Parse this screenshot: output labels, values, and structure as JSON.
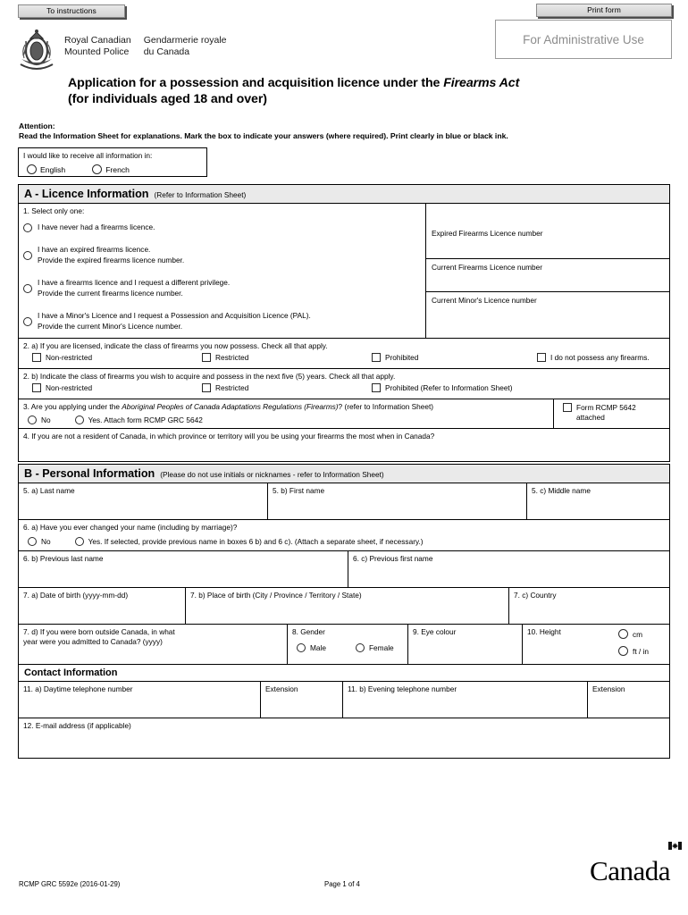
{
  "toolbar": {
    "to_instructions": "To instructions",
    "print_form": "Print form"
  },
  "admin": {
    "label": "For Administrative Use"
  },
  "org": {
    "name_en_line1": "Royal Canadian",
    "name_en_line2": "Mounted Police",
    "name_fr_line1": "Gendarmerie royale",
    "name_fr_line2": "du Canada"
  },
  "title": {
    "line1_a": "Application for a possession and acquisition licence under the ",
    "line1_italic": "Firearms Act",
    "line2": "(for individuals aged 18 and over)"
  },
  "attention": {
    "heading": "Attention:",
    "text": "Read the Information Sheet for explanations. Mark the box to indicate your answers (where required). Print clearly in blue or black ink."
  },
  "language": {
    "label": "I would like to receive all information in:",
    "options": [
      "English",
      "French"
    ]
  },
  "section_a": {
    "title": "A - Licence Information",
    "note": "(Refer to Information Sheet)",
    "q1": {
      "label": "1. Select only one:",
      "options": [
        {
          "line1": "I have never had a firearms licence.",
          "line2": ""
        },
        {
          "line1": "I have an expired firearms licence.",
          "line2": "Provide the expired firearms licence number."
        },
        {
          "line1": "I have a firearms licence and I request a different privilege.",
          "line2": "Provide the current firearms licence number."
        },
        {
          "line1": "I have a Minor's Licence and I request a Possession and Acquisition Licence (PAL).",
          "line2": "Provide the current Minor's Licence number."
        }
      ],
      "licence_boxes": [
        "Expired Firearms Licence number",
        "Current Firearms Licence number",
        "Current Minor's Licence number"
      ]
    },
    "q2a": {
      "label": "2. a) If you are licensed, indicate the class of firearms you now possess. Check all that apply.",
      "options": [
        "Non-restricted",
        "Restricted",
        "Prohibited",
        "I do not possess any firearms."
      ]
    },
    "q2b": {
      "label": "2. b) Indicate the class of firearms you wish to acquire and possess in the next five (5) years. Check all that apply.",
      "options": [
        "Non-restricted",
        "Restricted",
        "Prohibited (Refer to Information Sheet)"
      ]
    },
    "q3": {
      "label_a": "3. Are you applying under the ",
      "label_italic": "Aboriginal Peoples of Canada Adaptations Regulations (Firearms)",
      "label_b": "? (refer to Information Sheet)",
      "options": [
        "No",
        "Yes. Attach form RCMP GRC 5642"
      ],
      "attached_label_line1": "Form RCMP 5642",
      "attached_label_line2": "attached"
    },
    "q4": {
      "label": "4. If you are not a resident of Canada, in which province or territory will you be using your firearms the most when in Canada?"
    }
  },
  "section_b": {
    "title": "B - Personal Information",
    "note": "(Please do not use initials or nicknames - refer to Information Sheet)",
    "q5a": "5. a) Last name",
    "q5b": "5. b) First name",
    "q5c": "5. c) Middle name",
    "q6a": {
      "label": "6. a) Have you ever changed your name (including by marriage)?",
      "options": [
        "No",
        "Yes. If selected, provide previous name in boxes 6 b) and 6 c). (Attach a separate sheet, if necessary.)"
      ]
    },
    "q6b": "6. b) Previous last name",
    "q6c": "6. c) Previous first name",
    "q7a": "7. a) Date of birth (yyyy-mm-dd)",
    "q7b": "7. b) Place of birth (City / Province / Territory / State)",
    "q7c": "7. c) Country",
    "q7d_line1": "7. d) If you were born outside Canada, in what",
    "q7d_line2": "year were you admitted to Canada? (yyyy)",
    "q8": {
      "label": "8. Gender",
      "options": [
        "Male",
        "Female"
      ]
    },
    "q9": "9. Eye colour",
    "q10": {
      "label": "10. Height",
      "units": [
        "cm",
        "ft / in"
      ]
    },
    "contact_title": "Contact Information",
    "q11a": "11. a) Daytime telephone number",
    "q11a_ext": "Extension",
    "q11b": "11. b) Evening telephone number",
    "q11b_ext": "Extension",
    "q12": "12. E-mail address (if applicable)"
  },
  "footer": {
    "form_number": "RCMP GRC 5592e (2016-01-29)",
    "page": "Page 1 of 4",
    "wordmark": "Canad"
  }
}
